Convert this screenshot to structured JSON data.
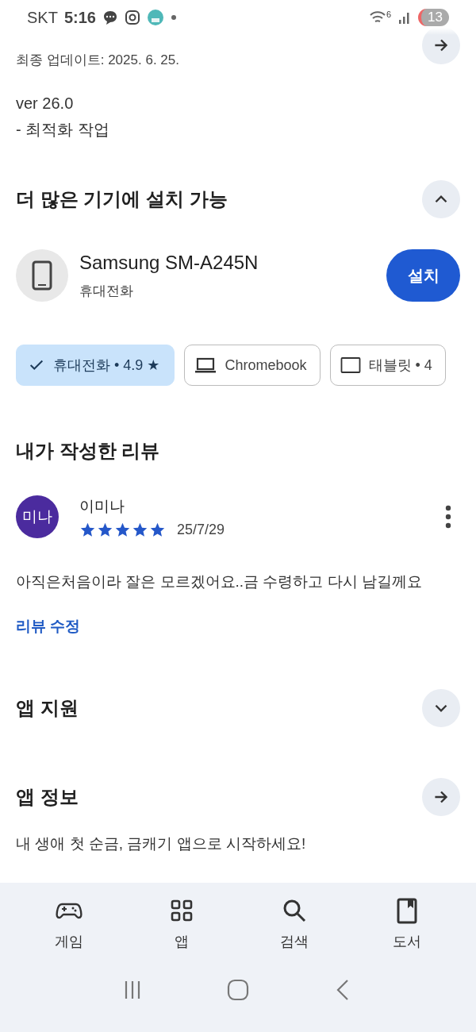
{
  "status_bar": {
    "carrier": "SKT",
    "time": "5:16",
    "wifi_label": "6",
    "notification_count": "13"
  },
  "update": {
    "last_updated": "최종 업데이트: 2025. 6. 25.",
    "version": "ver 26.0",
    "notes": "- 최적화 작업"
  },
  "devices_section": {
    "title": "더 많은 기기에 설치 가능",
    "expanded": true,
    "device": {
      "name": "Samsung SM-A245N",
      "type": "휴대전화",
      "install_button": "설치"
    },
    "chips": [
      {
        "label": "휴대전화 • 4.9 ★",
        "selected": true
      },
      {
        "kind": "laptop",
        "label": "Chromebook",
        "selected": false
      },
      {
        "kind": "tablet",
        "label": "태블릿 • 4",
        "selected": false
      }
    ]
  },
  "my_review": {
    "title": "내가 작성한 리뷰",
    "avatar_text": "미나",
    "author": "이미나",
    "stars": 5,
    "date": "25/7/29",
    "text": "아직은처음이라 잘은 모르겠어요..금 수령하고 다시 남길께요",
    "edit_link": "리뷰 수정"
  },
  "app_support": {
    "title": "앱 지원",
    "expanded": false
  },
  "app_info": {
    "title": "앱 정보",
    "description": "내 생애 첫 순금, 금캐기 앱으로 시작하세요!"
  },
  "bottom_nav": [
    {
      "kind": "games",
      "label": "게임",
      "selected": false
    },
    {
      "kind": "apps",
      "label": "앱",
      "selected": false
    },
    {
      "kind": "search",
      "label": "검색",
      "selected": false
    },
    {
      "kind": "books",
      "label": "도서",
      "selected": false
    }
  ]
}
